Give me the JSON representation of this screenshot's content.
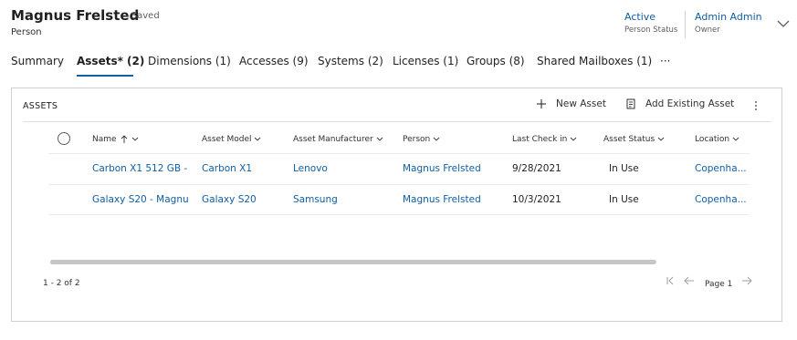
{
  "header": {
    "title": "Magnus Frelsted",
    "saved_text": "- Saved",
    "entity_type": "Person",
    "status_value": "Active",
    "status_label": "Person Status",
    "owner_value": "Admin Admin",
    "owner_label": "Owner"
  },
  "tabs": [
    {
      "label": "Summary"
    },
    {
      "label": "Assets* (2)"
    },
    {
      "label": "Dimensions (1)"
    },
    {
      "label": "Accesses (9)"
    },
    {
      "label": "Systems (2)"
    },
    {
      "label": "Licenses (1)"
    },
    {
      "label": "Groups (8)"
    },
    {
      "label": "Shared Mailboxes (1)"
    },
    {
      "label": "···"
    }
  ],
  "active_tab": "Assets* (2)",
  "assets": {
    "title": "ASSETS",
    "new_label": "New Asset",
    "existing_label": "Add Existing Asset",
    "columns": [
      "Name",
      "Asset Model",
      "Asset Manufacturer",
      "Person",
      "Last Check in",
      "Asset Status",
      "Location"
    ],
    "rows": [
      [
        "Carbon X1 512 GB -",
        "Carbon X1",
        "Lenovo",
        "Magnus Frelsted",
        "9/28/2021",
        "In Use",
        "Copenha..."
      ],
      [
        "Galaxy S20 - Magnu",
        "Galaxy S20",
        "Samsung",
        "Magnus Frelsted",
        "10/3/2021",
        "In Use",
        "Copenha..."
      ]
    ],
    "record_count": "1 - 2 of 2",
    "page_label": "Page 1"
  },
  "colors": {
    "link": "#115ea3",
    "text": "#323130",
    "border": "#d2d0ce"
  }
}
